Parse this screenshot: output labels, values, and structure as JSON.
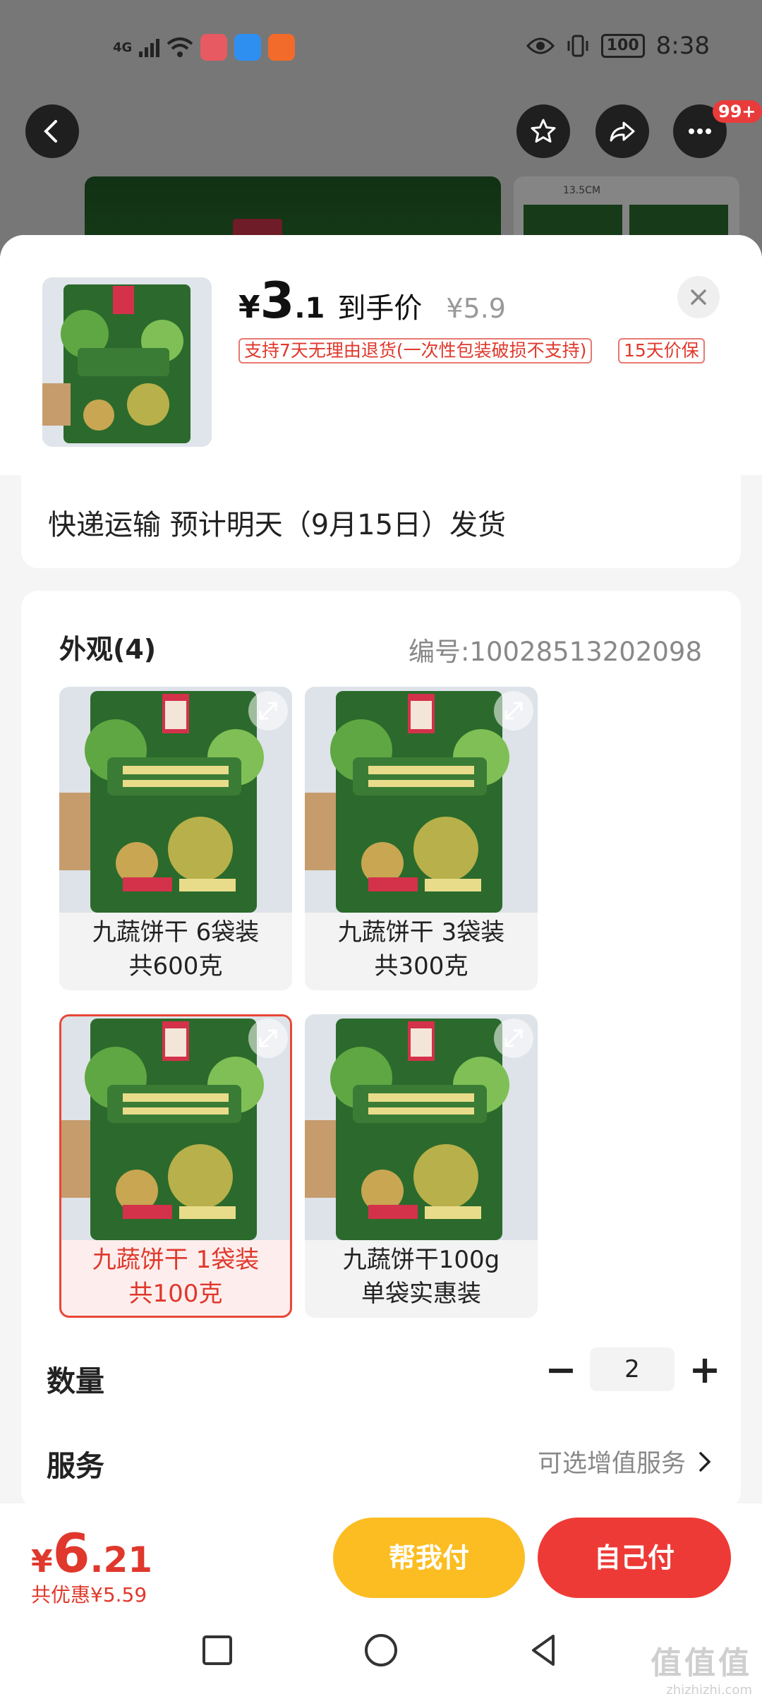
{
  "status_bar": {
    "network": "4G",
    "time": "8:38",
    "battery": "100"
  },
  "nav": {
    "badge": "99+"
  },
  "product": {
    "price_symbol": "¥",
    "price_int": "3",
    "price_dec": ".1",
    "price_label": "到手价",
    "original_price": "¥5.9",
    "policy_return": "支持7天无理由退货(一次性包装破损不支持)",
    "policy_price": "15天价保"
  },
  "shipping": {
    "text": "快递运输 预计明天（9月15日）发货"
  },
  "variants": {
    "title": "外观(4)",
    "sku_number": "编号:10028513202098",
    "options": [
      {
        "line1": "九蔬饼干 6袋装",
        "line2": "共600克",
        "selected": false
      },
      {
        "line1": "九蔬饼干 3袋装",
        "line2": "共300克",
        "selected": false
      },
      {
        "line1": "九蔬饼干  1袋装",
        "line2": "共100克",
        "selected": true
      },
      {
        "line1": "九蔬饼干100g",
        "line2": "单袋实惠装",
        "selected": false
      }
    ]
  },
  "quantity": {
    "label": "数量",
    "minus": "−",
    "value": "2",
    "plus": "+"
  },
  "service": {
    "label": "服务",
    "link": "可选增值服务"
  },
  "footer": {
    "total_symbol": "¥",
    "total_int": "6",
    "total_dec": ".21",
    "discount": "共优惠¥5.59",
    "help_pay": "帮我付",
    "self_pay": "自己付"
  },
  "watermark": {
    "big": "值值值",
    "small": "zhizhizhi.com"
  },
  "colors": {
    "accent_red": "#e0382c",
    "button_yellow": "#fbbd22",
    "button_red": "#ee3a36",
    "package_green": "#2b6a2c"
  }
}
